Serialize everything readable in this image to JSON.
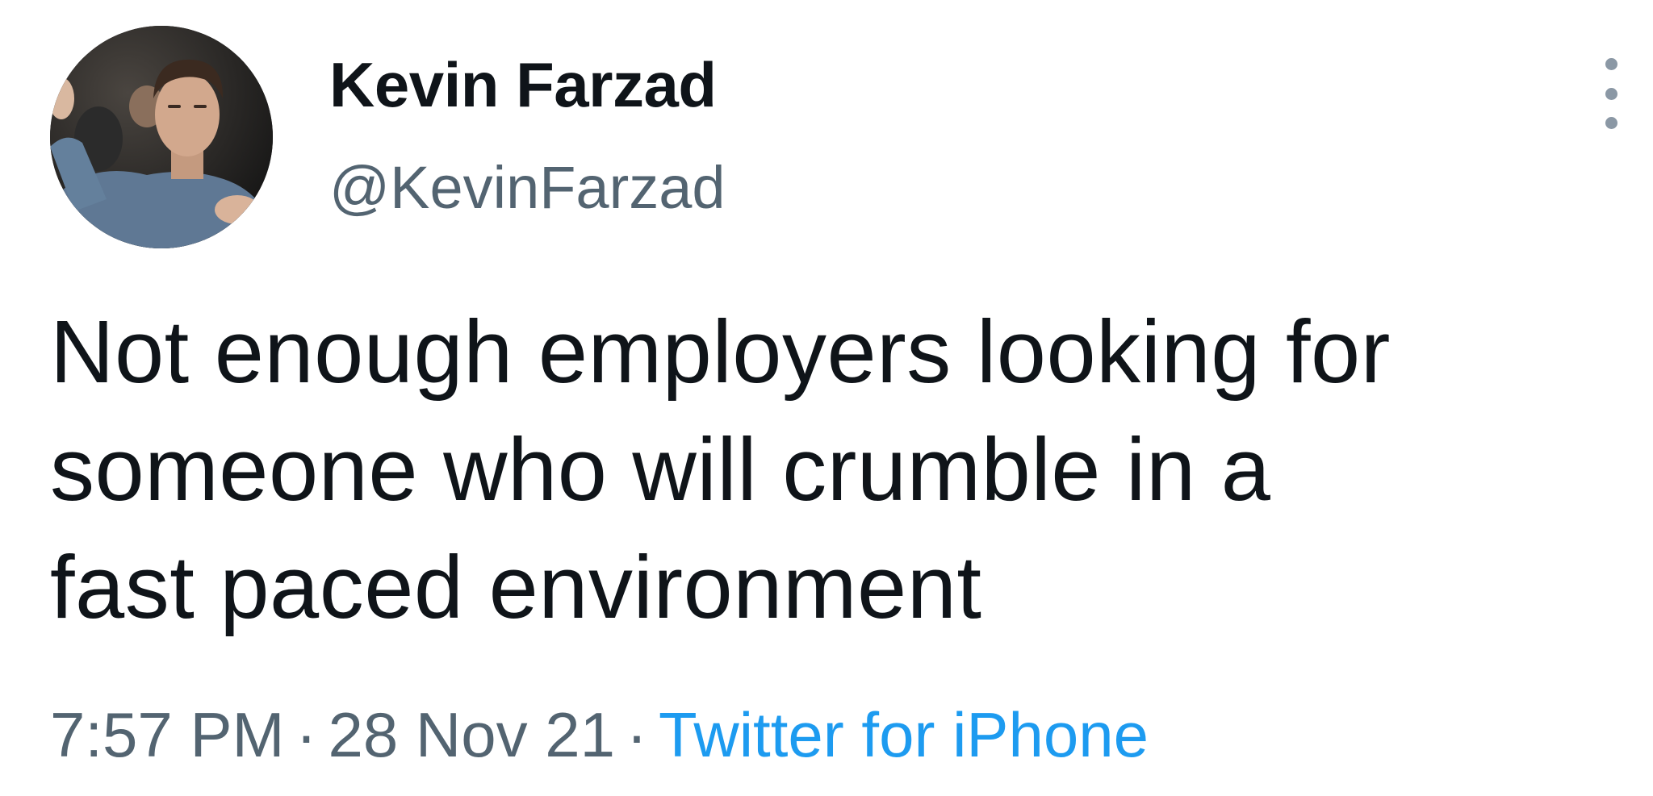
{
  "author": {
    "display_name": "Kevin Farzad",
    "handle": "@KevinFarzad",
    "avatar_icon": "profile-photo"
  },
  "tweet": {
    "lines": [
      "Not enough employers looking for",
      "someone who will crumble in a",
      "fast paced environment"
    ],
    "text": "Not enough employers looking for\nsomeone who will crumble in a\nfast paced environment"
  },
  "meta": {
    "time": "7:57 PM",
    "separator": "·",
    "date": "28 Nov 21",
    "source": "Twitter for iPhone"
  },
  "actions": {
    "more_icon": "more-vertical-icon"
  },
  "colors": {
    "text_primary": "#0f1419",
    "text_secondary": "#536471",
    "link": "#1d9bf0",
    "background": "#ffffff"
  }
}
